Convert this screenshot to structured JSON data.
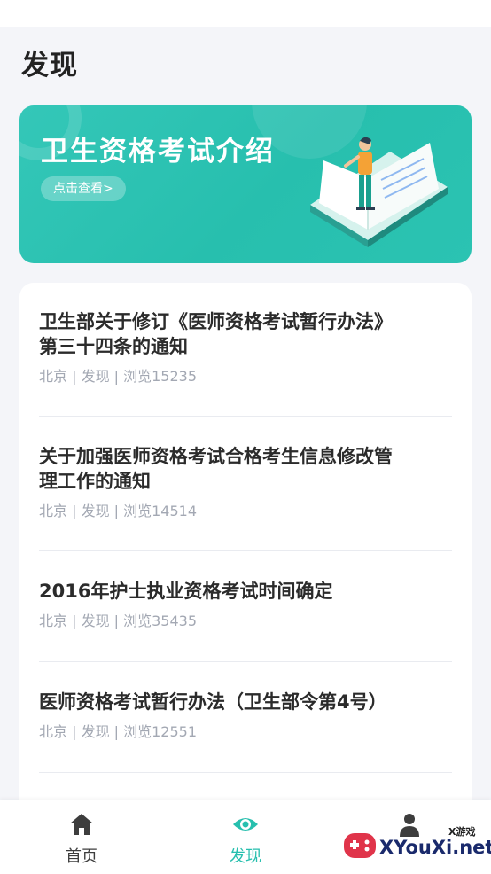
{
  "header": {
    "title": "发现"
  },
  "banner": {
    "title": "卫生资格考试介绍",
    "button_label": "点击查看>"
  },
  "news": [
    {
      "title_line1": "卫生部关于修订《医师资格考试暂行办法》",
      "title_line2": "第三十四条的通知",
      "meta": "北京 | 发现 | 浏览15235"
    },
    {
      "title_line1": "关于加强医师资格考试合格考生信息修改管",
      "title_line2": "理工作的通知",
      "meta": "北京 | 发现 | 浏览14514"
    },
    {
      "title_line1": "2016年护士执业资格考试时间确定",
      "title_line2": "",
      "meta": "北京 | 发现 | 浏览35435"
    },
    {
      "title_line1": "医师资格考试暂行办法（卫生部令第4号）",
      "title_line2": "",
      "meta": "北京 | 发现 | 浏览12551"
    }
  ],
  "tabbar": {
    "home_label": "首页",
    "discover_label": "发现",
    "home_icon": "home-icon",
    "discover_icon": "eye-icon",
    "profile_icon": "user-icon"
  },
  "watermark": {
    "small": "X游戏",
    "text": "XYouXi.net"
  },
  "colors": {
    "accent": "#27bfae",
    "background": "#f4f5f9"
  }
}
